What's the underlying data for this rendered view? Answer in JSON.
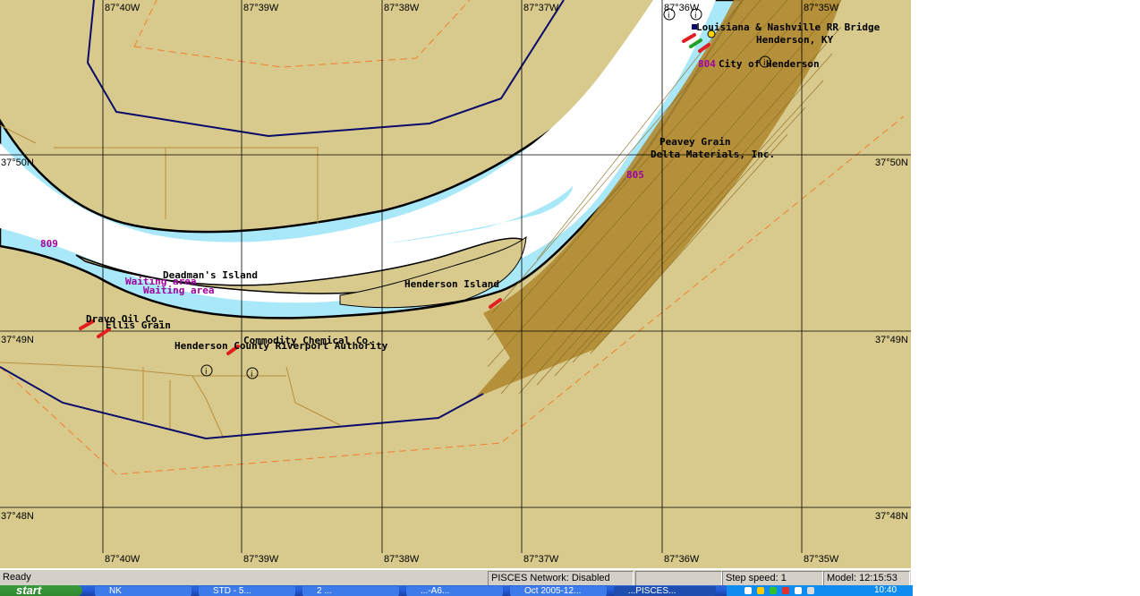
{
  "map": {
    "lat_labels": [
      "37°50N",
      "37°49N",
      "37°48N"
    ],
    "lon_labels": [
      "87°40W",
      "87°39W",
      "87°38W",
      "87°37W",
      "87°36W",
      "87°35W"
    ],
    "features": {
      "rr_bridge": "Louisiana & Nashville RR Bridge",
      "henderson_ky": "Henderson, KY",
      "city_henderson": "City of Henderson",
      "peavey": "Peavey Grain",
      "delta": "Delta Materials, Inc.",
      "deadmans": "Deadman's Island",
      "henderson_island": "Henderson Island",
      "waiting1": "Waiting area",
      "waiting2": "Waiting area",
      "oil_co": "Dravo Oil Co.",
      "ellis": "Ellis Grain",
      "chem": "Commodity Chemical Co.",
      "port": "Henderson County Riverport Authority",
      "mile_809": "809",
      "mile_805": "805",
      "mile_804": "804"
    },
    "colors": {
      "land": "#d8c98c",
      "shallow": "#a8e8f8",
      "deep": "#ffffff",
      "shore": "#000000",
      "boundary": "#0a0a6a",
      "dashed": "#f08030",
      "roads": "#b89040",
      "urban": "#b08a32",
      "magenta": "#a000a0"
    }
  },
  "status": {
    "ready": "Ready",
    "network": "PISCES Network: Disabled",
    "empty": "",
    "step": "Step speed: 1",
    "model": "Model: 12:15:53"
  },
  "taskbar": {
    "start": "start",
    "tasks": [
      "NK",
      "STD - 5...",
      "2 ...",
      "...-A6...",
      "Oct 2005-12...",
      "...PISCES..."
    ],
    "clock": "10:40"
  }
}
